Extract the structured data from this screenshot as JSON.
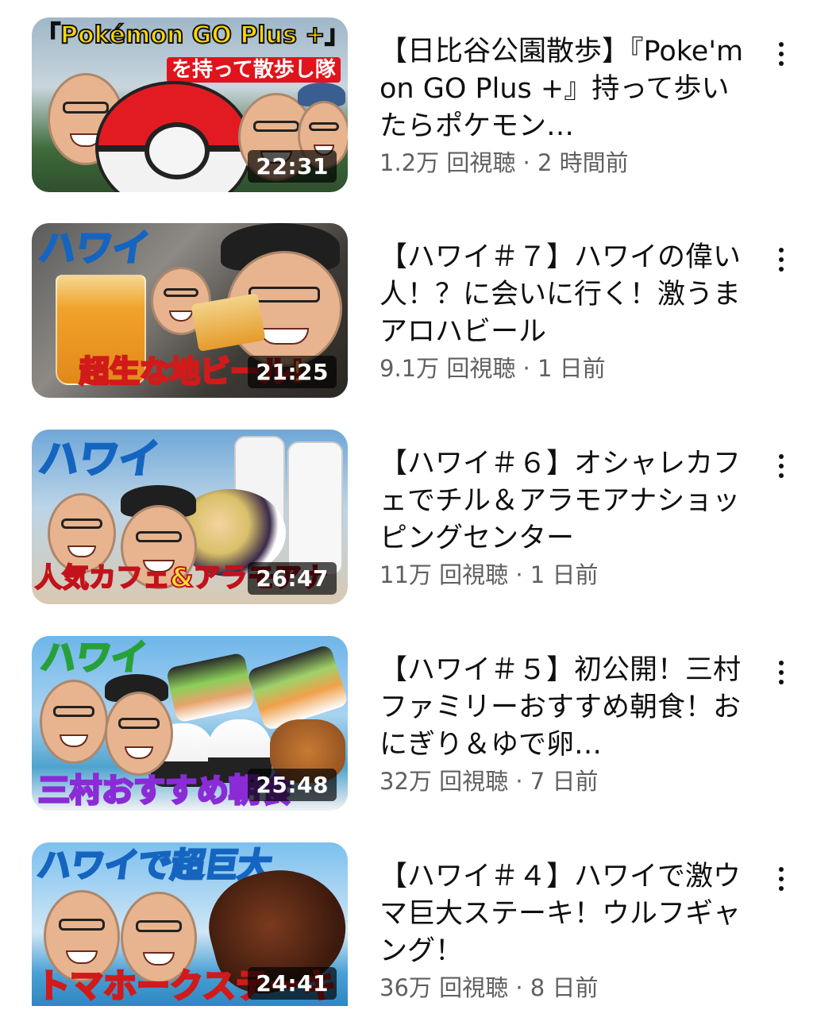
{
  "videos": [
    {
      "title": "【日比谷公園散歩】『Poke'mon GO Plus +』持って歩いたらポケモン…",
      "views": "1.2万 回視聴",
      "age": "2 時間前",
      "duration": "22:31",
      "thumb_text_1": "「Pokémon GO Plus +」",
      "thumb_text_2": "を持って散歩し隊"
    },
    {
      "title": "【ハワイ＃７】ハワイの偉い人！？に会いに行く！激うまアロハビール",
      "views": "9.1万 回視聴",
      "age": "1 日前",
      "duration": "21:25",
      "thumb_text_1": "ハワイ",
      "thumb_text_2": "超生な地ビール!"
    },
    {
      "title": "【ハワイ＃６】オシャレカフェでチル＆アラモアナショッピングセンター",
      "views": "11万 回視聴",
      "age": "1 日前",
      "duration": "26:47",
      "thumb_text_1": "ハワイ",
      "thumb_text_2": "人気カフェ&アラモアナ"
    },
    {
      "title": "【ハワイ＃５】初公開！三村ファミリーおすすめ朝食！おにぎり＆ゆで卵…",
      "views": "32万 回視聴",
      "age": "7 日前",
      "duration": "25:48",
      "thumb_text_1": "ハワイ",
      "thumb_text_2": "三村おすすめ朝食"
    },
    {
      "title": "【ハワイ＃４】ハワイで激ウマ巨大ステーキ！ウルフギャング！",
      "views": "36万 回視聴",
      "age": "8 日前",
      "duration": "24:41",
      "thumb_text_1": "ハワイで超巨大",
      "thumb_text_2": "トマホークステーキ"
    }
  ],
  "separator": " · ",
  "icons": {
    "menu": "more-vertical-icon"
  },
  "colors": {
    "title": "#0f0f0f",
    "meta": "#606060",
    "duration_bg": "#000000"
  }
}
